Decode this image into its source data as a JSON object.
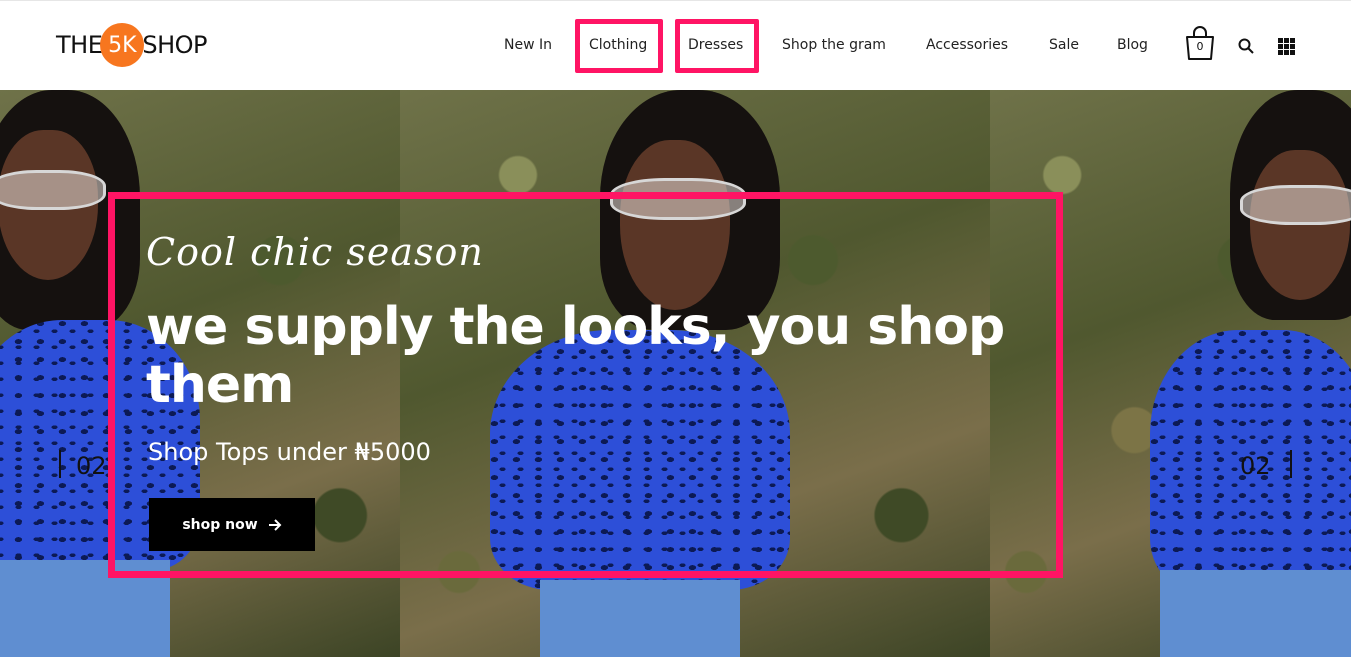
{
  "header": {
    "logo": {
      "left": "THE",
      "badge": "5K",
      "right": "SHOP"
    },
    "nav": [
      "New In",
      "Clothing",
      "Dresses",
      "Shop the gram",
      "Accessories",
      "Sale",
      "Blog"
    ],
    "cart_count": "0",
    "icons": [
      "cart-icon",
      "search-icon",
      "grid-menu-icon"
    ]
  },
  "hero": {
    "script_title": "Cool chic season",
    "headline": "we supply the looks, you shop them",
    "subline": "Shop Tops under ₦5000",
    "cta_label": "shop now",
    "cta_icon": "arrow-right-icon",
    "prev_slide": "02",
    "next_slide": "02"
  },
  "colors": {
    "highlight": "#ff1464",
    "logo_badge": "#f7761f",
    "cta_bg": "#000000"
  }
}
